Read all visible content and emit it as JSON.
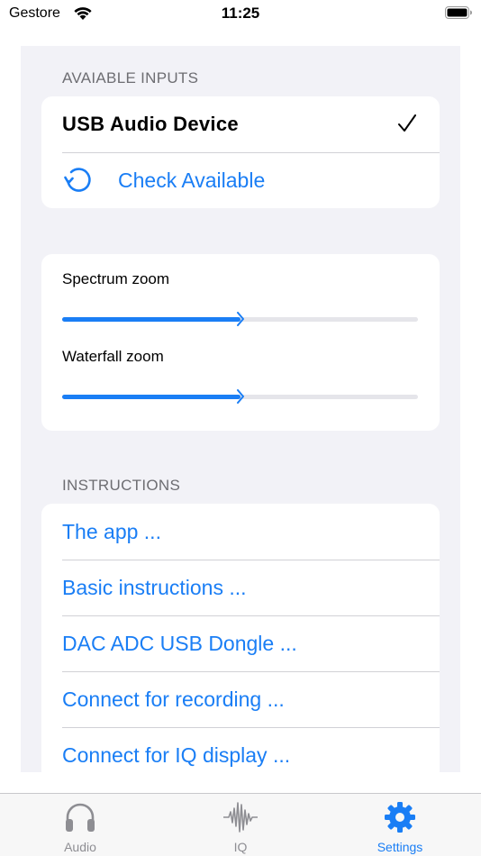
{
  "status_bar": {
    "carrier": "Gestore",
    "time": "11:25"
  },
  "inputs_section": {
    "header": "AVAIABLE INPUTS",
    "device": "USB Audio Device",
    "device_selected": true,
    "check_label": "Check Available"
  },
  "zoom_section": {
    "spectrum_label": "Spectrum zoom",
    "spectrum_value": 0.5,
    "waterfall_label": "Waterfall zoom",
    "waterfall_value": 0.5
  },
  "instructions_section": {
    "header": "INSTRUCTIONS",
    "items": [
      "The app ...",
      "Basic instructions ...",
      "DAC ADC USB Dongle ...",
      "Connect for recording ...",
      "Connect for IQ display ..."
    ]
  },
  "tab_bar": {
    "tabs": [
      {
        "label": "Audio",
        "icon": "headphones-icon"
      },
      {
        "label": "IQ",
        "icon": "waveform-icon"
      },
      {
        "label": "Settings",
        "icon": "gear-icon"
      }
    ],
    "active": "Settings"
  },
  "colors": {
    "accent": "#1a7ef5",
    "background": "#f2f2f7",
    "secondary_text": "#6d6d72"
  }
}
